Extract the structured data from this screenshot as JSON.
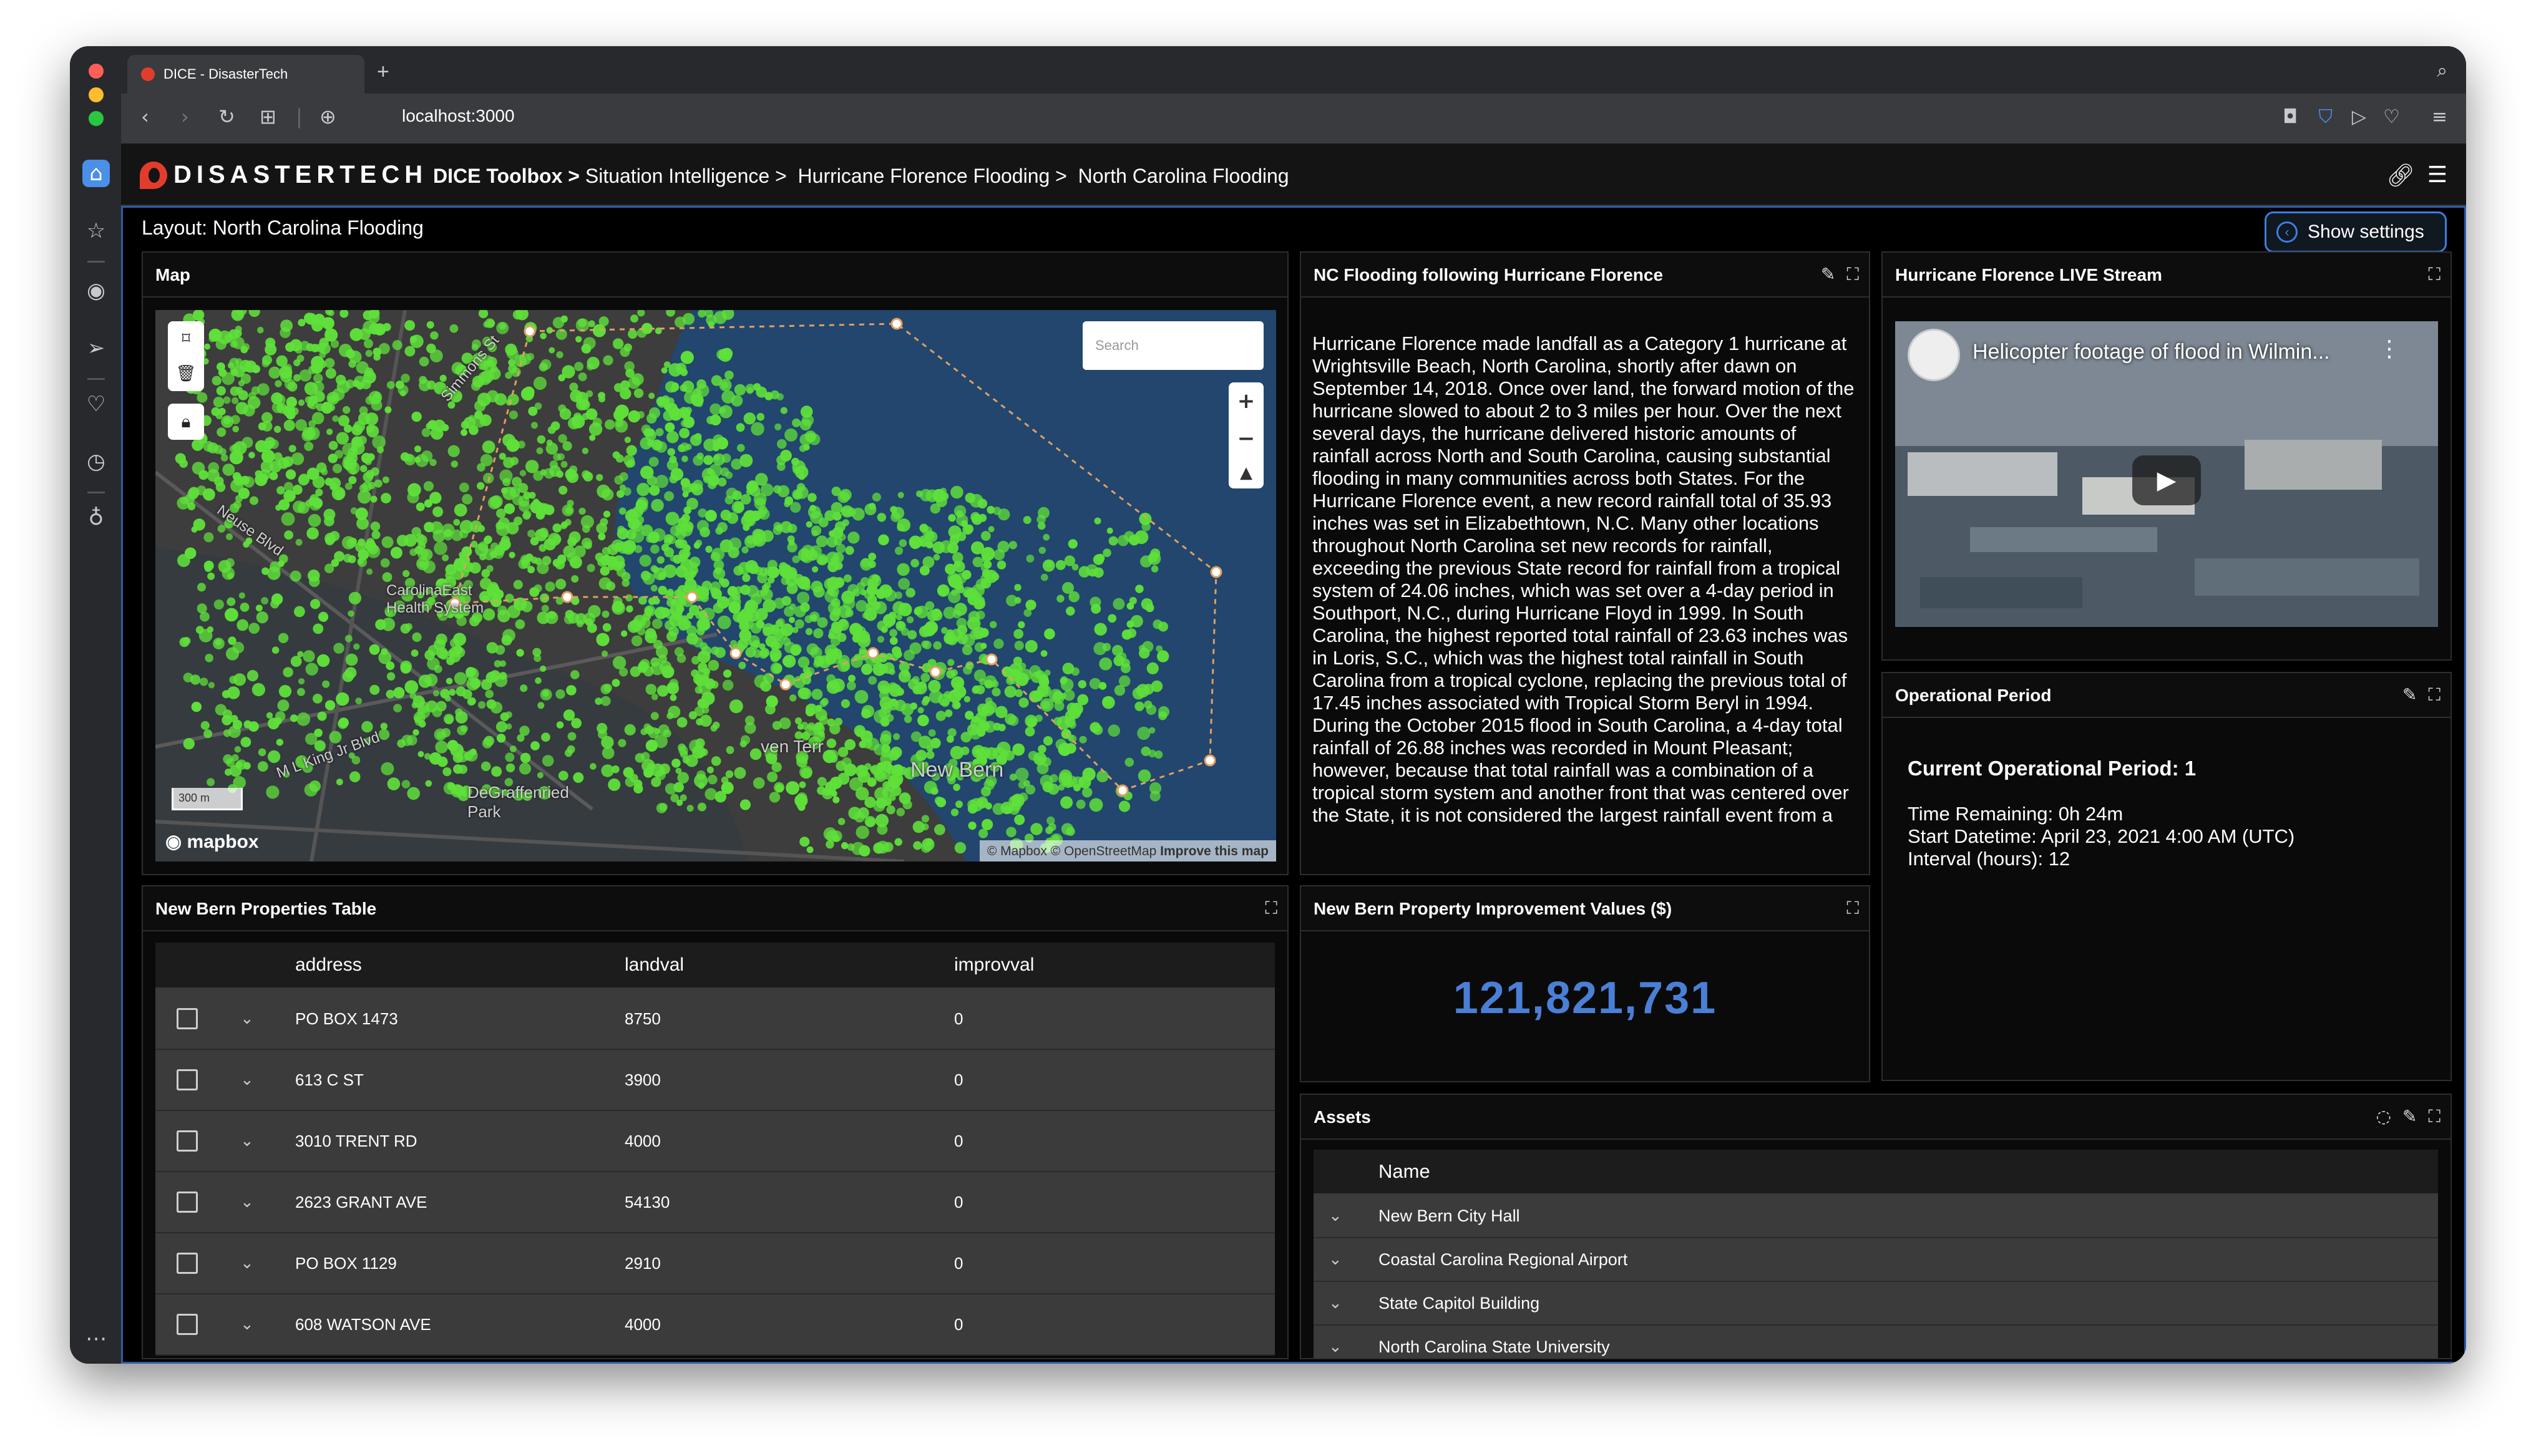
{
  "browser": {
    "tab_title": "DICE - DisasterTech",
    "new_tab": "+",
    "url": "localhost:3000"
  },
  "app": {
    "logo_text": "DISASTERTECH",
    "breadcrumb_root": "DICE Toolbox >",
    "breadcrumb_rest": "Situation Intelligence >  Hurricane Florence Flooding >  North Carolina Flooding",
    "layout_label": "Layout: North Carolina Flooding",
    "settings_label": "Show settings"
  },
  "map_panel": {
    "title": "Map",
    "search_placeholder": "Search",
    "scale_label": "300 m",
    "mapbox_label": "mapbox",
    "attribution_prefix": "© Mapbox © OpenStreetMap",
    "attribution_link": "Improve this map",
    "labels": {
      "health": "CarolinaEast\nHealth System",
      "newbern": "New Bern",
      "terr": "ven Terr",
      "park": "DeGraffenried\nPark",
      "mlk": "M L King Jr Blvd",
      "neuse": "Neuse Blvd",
      "simmons": "Simmons St"
    }
  },
  "nc_text_panel": {
    "title": "NC Flooding following Hurricane Florence",
    "body": "Hurricane Florence made landfall as a Category 1 hurricane at Wrightsville Beach, North Carolina, shortly after dawn on September 14, 2018. Once over land, the forward motion of the hurricane slowed to about 2 to 3 miles per hour. Over the next several days, the hurricane delivered historic amounts of rainfall across North and South Carolina, causing substantial flooding in many communities across both States. For the Hurricane Florence event, a new record rainfall total of 35.93 inches was set in Elizabethtown, N.C. Many other locations throughout North Carolina set new records for rainfall, exceeding the previous State record for rainfall from a tropical system of 24.06 inches, which was set over a 4-day period in Southport, N.C., during Hurricane Floyd in 1999. In South Carolina, the highest reported total rainfall of 23.63 inches was in Loris, S.C., which was the highest total rainfall in South Carolina from a tropical cyclone, replacing the previous total of 17.45 inches associated with Tropical Storm Beryl in 1994. During the October 2015 flood in South Carolina, a 4-day total rainfall of 26.88 inches was recorded in Mount Pleasant; however, because that total rainfall was a combination of a tropical storm system and another front that was centered over the State, it is not considered the largest rainfall event from a"
  },
  "live_stream": {
    "title": "Hurricane Florence LIVE Stream",
    "video_title": "Helicopter footage of flood in Wilmin..."
  },
  "op_period": {
    "title": "Operational Period",
    "current": "Current Operational Period: 1",
    "time_remaining": "Time Remaining: 0h 24m",
    "start": "Start Datetime: April 23, 2021 4:00 AM (UTC)",
    "interval": "Interval (hours): 12"
  },
  "properties_table": {
    "title": "New Bern Properties Table",
    "columns": [
      "address",
      "landval",
      "improvval"
    ],
    "rows": [
      [
        "PO BOX 1473",
        "8750",
        "0"
      ],
      [
        "613 C ST",
        "3900",
        "0"
      ],
      [
        "3010 TRENT RD",
        "4000",
        "0"
      ],
      [
        "2623 GRANT AVE",
        "54130",
        "0"
      ],
      [
        "PO BOX 1129",
        "2910",
        "0"
      ],
      [
        "608 WATSON AVE",
        "4000",
        "0"
      ]
    ]
  },
  "improvement": {
    "title": "New Bern Property Improvement Values ($)",
    "value": "121,821,731"
  },
  "assets": {
    "title": "Assets",
    "column": "Name",
    "rows": [
      "New Bern City Hall",
      "Coastal Carolina Regional Airport",
      "State Capitol Building",
      "North Carolina State University"
    ]
  },
  "colors": {
    "accent": "#3d7ee0",
    "value_blue": "#4a7fd6",
    "property_green": "#5fe03a",
    "flood_blue": "#22466e"
  }
}
